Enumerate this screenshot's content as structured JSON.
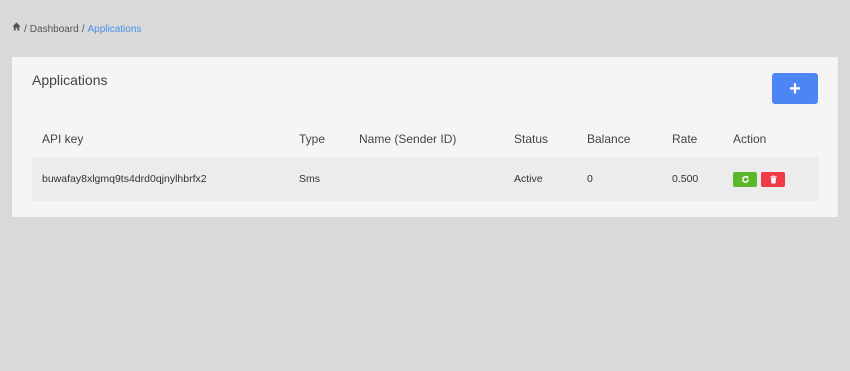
{
  "breadcrumb": {
    "separator": "/",
    "items": [
      "Dashboard"
    ],
    "current": "Applications"
  },
  "card": {
    "title": "Applications",
    "add_button_label": "+"
  },
  "table": {
    "columns": [
      "API key",
      "Type",
      "Name (Sender ID)",
      "Status",
      "Balance",
      "Rate",
      "Action"
    ],
    "rows": [
      {
        "api_key": "buwafay8xlgmq9ts4drd0qjnylhbrfx2",
        "type": "Sms",
        "name": "",
        "status": "Active",
        "balance": "0",
        "rate": "0.500"
      }
    ]
  },
  "colors": {
    "primary": "#4c85f5",
    "success": "#5cb82a",
    "danger": "#ee3b46",
    "link_active": "#4a8fe8"
  },
  "icons": [
    "home-icon",
    "plus-icon",
    "refresh-icon",
    "trash-icon"
  ]
}
